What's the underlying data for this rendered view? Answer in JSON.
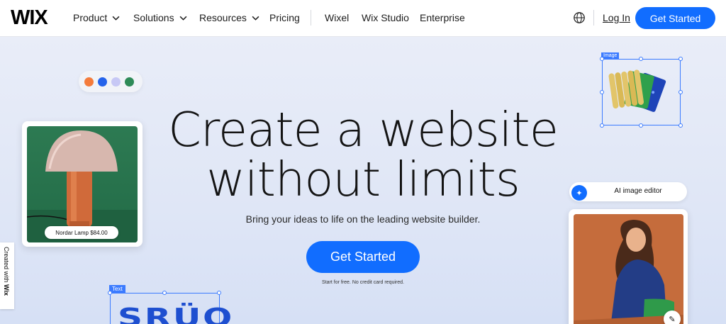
{
  "nav": {
    "logo": "WIX",
    "items": [
      {
        "label": "Product",
        "dropdown": true
      },
      {
        "label": "Solutions",
        "dropdown": true
      },
      {
        "label": "Resources",
        "dropdown": true
      },
      {
        "label": "Pricing",
        "dropdown": false
      }
    ],
    "secondary": [
      "Wixel",
      "Wix Studio",
      "Enterprise"
    ],
    "login": "Log In",
    "cta": "Get Started",
    "icons": {
      "globe": "globe-icon",
      "chevron": "chevron-down-icon"
    }
  },
  "hero": {
    "headline_line1": "Create a website",
    "headline_line2": "without limits",
    "subtitle": "Bring your ideas to life on the leading website builder.",
    "cta": "Get Started",
    "fineprint": "Start for free. No credit card required."
  },
  "decor": {
    "swatches": [
      "#f47b3b",
      "#2563eb",
      "#c7c8f5",
      "#2e8a57"
    ],
    "product_label": "Nordar Lamp $84.00",
    "image_tag": "Image",
    "ai_editor_label": "AI image editor",
    "text_tag": "Text",
    "text_art": "SRÜO",
    "created_with": "Created with",
    "created_brand": "Wix"
  },
  "colors": {
    "accent": "#116dff",
    "hero_bg": "#e3e9f8",
    "selection": "#3b7bff"
  }
}
